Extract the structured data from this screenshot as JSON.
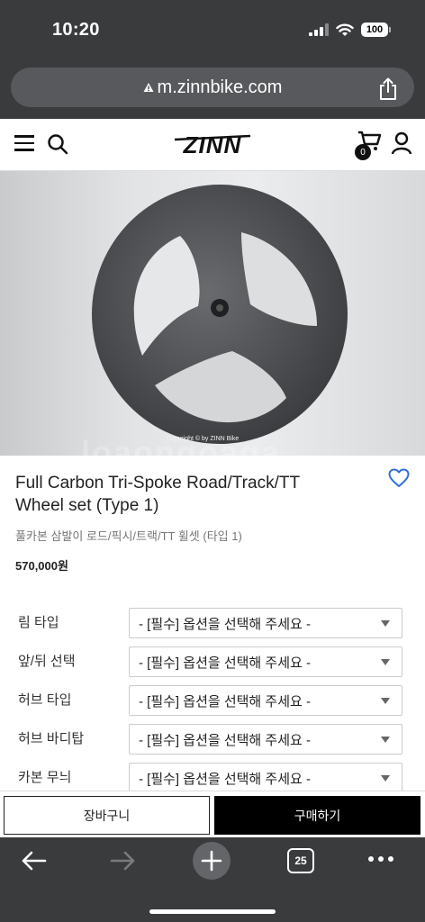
{
  "status_bar": {
    "time": "10:20",
    "battery": "100"
  },
  "browser": {
    "url": "m.zinnbike.com",
    "tab_count": "25"
  },
  "site": {
    "logo": "ZINN",
    "cart_count": "0"
  },
  "product": {
    "image_copyright": "Copyright © by ZINN Bike",
    "image_watermark": "loaongoaga",
    "title": "Full Carbon Tri-Spoke Road/Track/TT Wheel set (Type 1)",
    "subtitle": "풀카본 삼발이 로드/픽시/트랙/TT 휠셋 (타입 1)",
    "price": "570,000원"
  },
  "options": [
    {
      "label": "림 타입",
      "value": "- [필수] 옵션을 선택해 주세요 -"
    },
    {
      "label": "앞/뒤 선택",
      "value": "- [필수] 옵션을 선택해 주세요 -"
    },
    {
      "label": "허브 타입",
      "value": "- [필수] 옵션을 선택해 주세요 -"
    },
    {
      "label": "허브 바디탑",
      "value": "- [필수] 옵션을 선택해 주세요 -"
    },
    {
      "label": "카본 무늬",
      "value": "- [필수] 옵션을 선택해 주세요 -"
    }
  ],
  "actions": {
    "cart_label": "장바구니",
    "buy_label": "구매하기"
  },
  "icons": [
    "signal-icon",
    "wifi-icon",
    "battery-icon",
    "lock-icon",
    "share-icon",
    "menu-icon",
    "search-icon",
    "cart-icon",
    "user-icon",
    "heart-icon",
    "back-arrow-icon",
    "forward-arrow-icon",
    "new-tab-icon",
    "tabs-icon",
    "more-icon"
  ],
  "colors": {
    "chrome": "#3a3b3d",
    "accent": "#2f6fd6",
    "buy_button": "#000000"
  }
}
